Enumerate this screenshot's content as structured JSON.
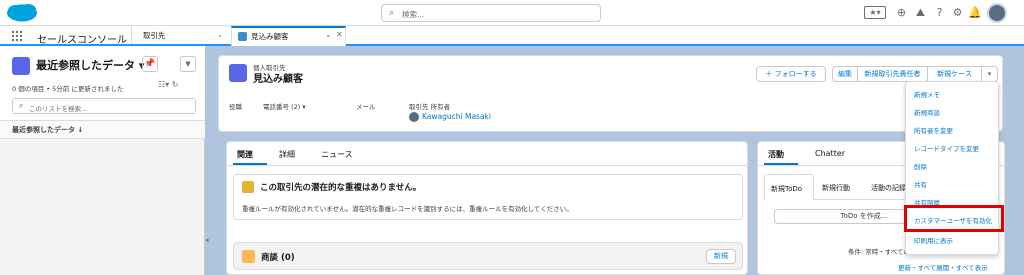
{
  "global": {
    "search_placeholder": "検索...",
    "fav_label": "★▾",
    "icons": [
      "plus-icon",
      "trailhead-icon",
      "help-icon",
      "gear-icon",
      "bell-icon"
    ]
  },
  "nav": {
    "app_name": "セールスコンソール",
    "tab1_label": "取引先",
    "tab2_label": "見込み顧客"
  },
  "list_view": {
    "title": "最近参照したデータ ▾",
    "meta": "0 個の項目 • 5分前 に更新されました",
    "search_placeholder": "このリストを検索...",
    "column_header": "最近参照したデータ ↓"
  },
  "record": {
    "type": "個人取引先",
    "name": "見込み顧客",
    "buttons": {
      "follow": "＋ フォローする",
      "edit": "編集",
      "new_owner": "新規取引先責任者",
      "new_case": "新規ケース",
      "more": "▾"
    },
    "fields": {
      "title_label": "役職",
      "phone_label": "電話番号 (2) ▾",
      "email_label": "メール",
      "owner_label": "取引先 所有者",
      "owner_value": "Kawaguchi Masaki"
    }
  },
  "main_tabs": [
    "関連",
    "詳細",
    "ニュース"
  ],
  "duplicates": {
    "title": "この取引先の潜在的な重複はありません。",
    "text": "重複ルールが有効化されていません。潜在的な重複レコードを識別するには、重複ルールを有効化してください。"
  },
  "opportunities": {
    "title": "商談 (0)",
    "new_button": "新規"
  },
  "activity": {
    "tabs": [
      "活動",
      "Chatter"
    ],
    "subtabs": [
      "新規ToDo",
      "新規行動",
      "活動の記録"
    ],
    "todo_button": "ToDo を作成...",
    "filter_text": "条件: 常時・すべての...",
    "expand_text": "更新・すべて展開・すべて表示"
  },
  "dropdown_menu": [
    "新規メモ",
    "新規商談",
    "所有者を変更",
    "レコードタイプを変更",
    "削除",
    "共有",
    "共有階層",
    "カスタマーユーザを有効化",
    "印刷用に表示"
  ],
  "colors": {
    "brand_blue": "#0176d3",
    "background": "#b0c4df",
    "highlight_red": "#e20000"
  }
}
